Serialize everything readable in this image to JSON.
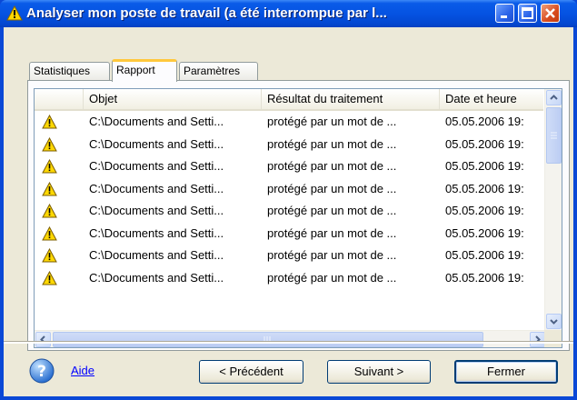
{
  "window": {
    "title": "Analyser mon poste de travail (a été interrompue par l..."
  },
  "tabs": [
    {
      "label": "Statistiques",
      "active": false
    },
    {
      "label": "Rapport",
      "active": true
    },
    {
      "label": "Paramètres",
      "active": false
    }
  ],
  "table": {
    "columns": [
      "Objet",
      "Résultat du traitement",
      "Date et heure"
    ],
    "rows": [
      {
        "icon": "warning-icon",
        "objet": "C:\\Documents and Setti...",
        "resultat": "protégé par un mot de ...",
        "date": "05.05.2006 19:"
      },
      {
        "icon": "warning-icon",
        "objet": "C:\\Documents and Setti...",
        "resultat": "protégé par un mot de ...",
        "date": "05.05.2006 19:"
      },
      {
        "icon": "warning-icon",
        "objet": "C:\\Documents and Setti...",
        "resultat": "protégé par un mot de ...",
        "date": "05.05.2006 19:"
      },
      {
        "icon": "warning-icon",
        "objet": "C:\\Documents and Setti...",
        "resultat": "protégé par un mot de ...",
        "date": "05.05.2006 19:"
      },
      {
        "icon": "warning-icon",
        "objet": "C:\\Documents and Setti...",
        "resultat": "protégé par un mot de ...",
        "date": "05.05.2006 19:"
      },
      {
        "icon": "warning-icon",
        "objet": "C:\\Documents and Setti...",
        "resultat": "protégé par un mot de ...",
        "date": "05.05.2006 19:"
      },
      {
        "icon": "warning-icon",
        "objet": "C:\\Documents and Setti...",
        "resultat": "protégé par un mot de ...",
        "date": "05.05.2006 19:"
      },
      {
        "icon": "warning-icon",
        "objet": "C:\\Documents and Setti...",
        "resultat": "protégé par un mot de ...",
        "date": "05.05.2006 19:"
      }
    ]
  },
  "footer": {
    "help_label": "Aide",
    "back_label": "< Précédent",
    "next_label": "Suivant >",
    "close_label": "Fermer"
  },
  "colors": {
    "titlebar": "#0553e2",
    "dialog_bg": "#ece9d8",
    "link": "#0000ff",
    "active_tab_accent": "#ffc83c"
  }
}
